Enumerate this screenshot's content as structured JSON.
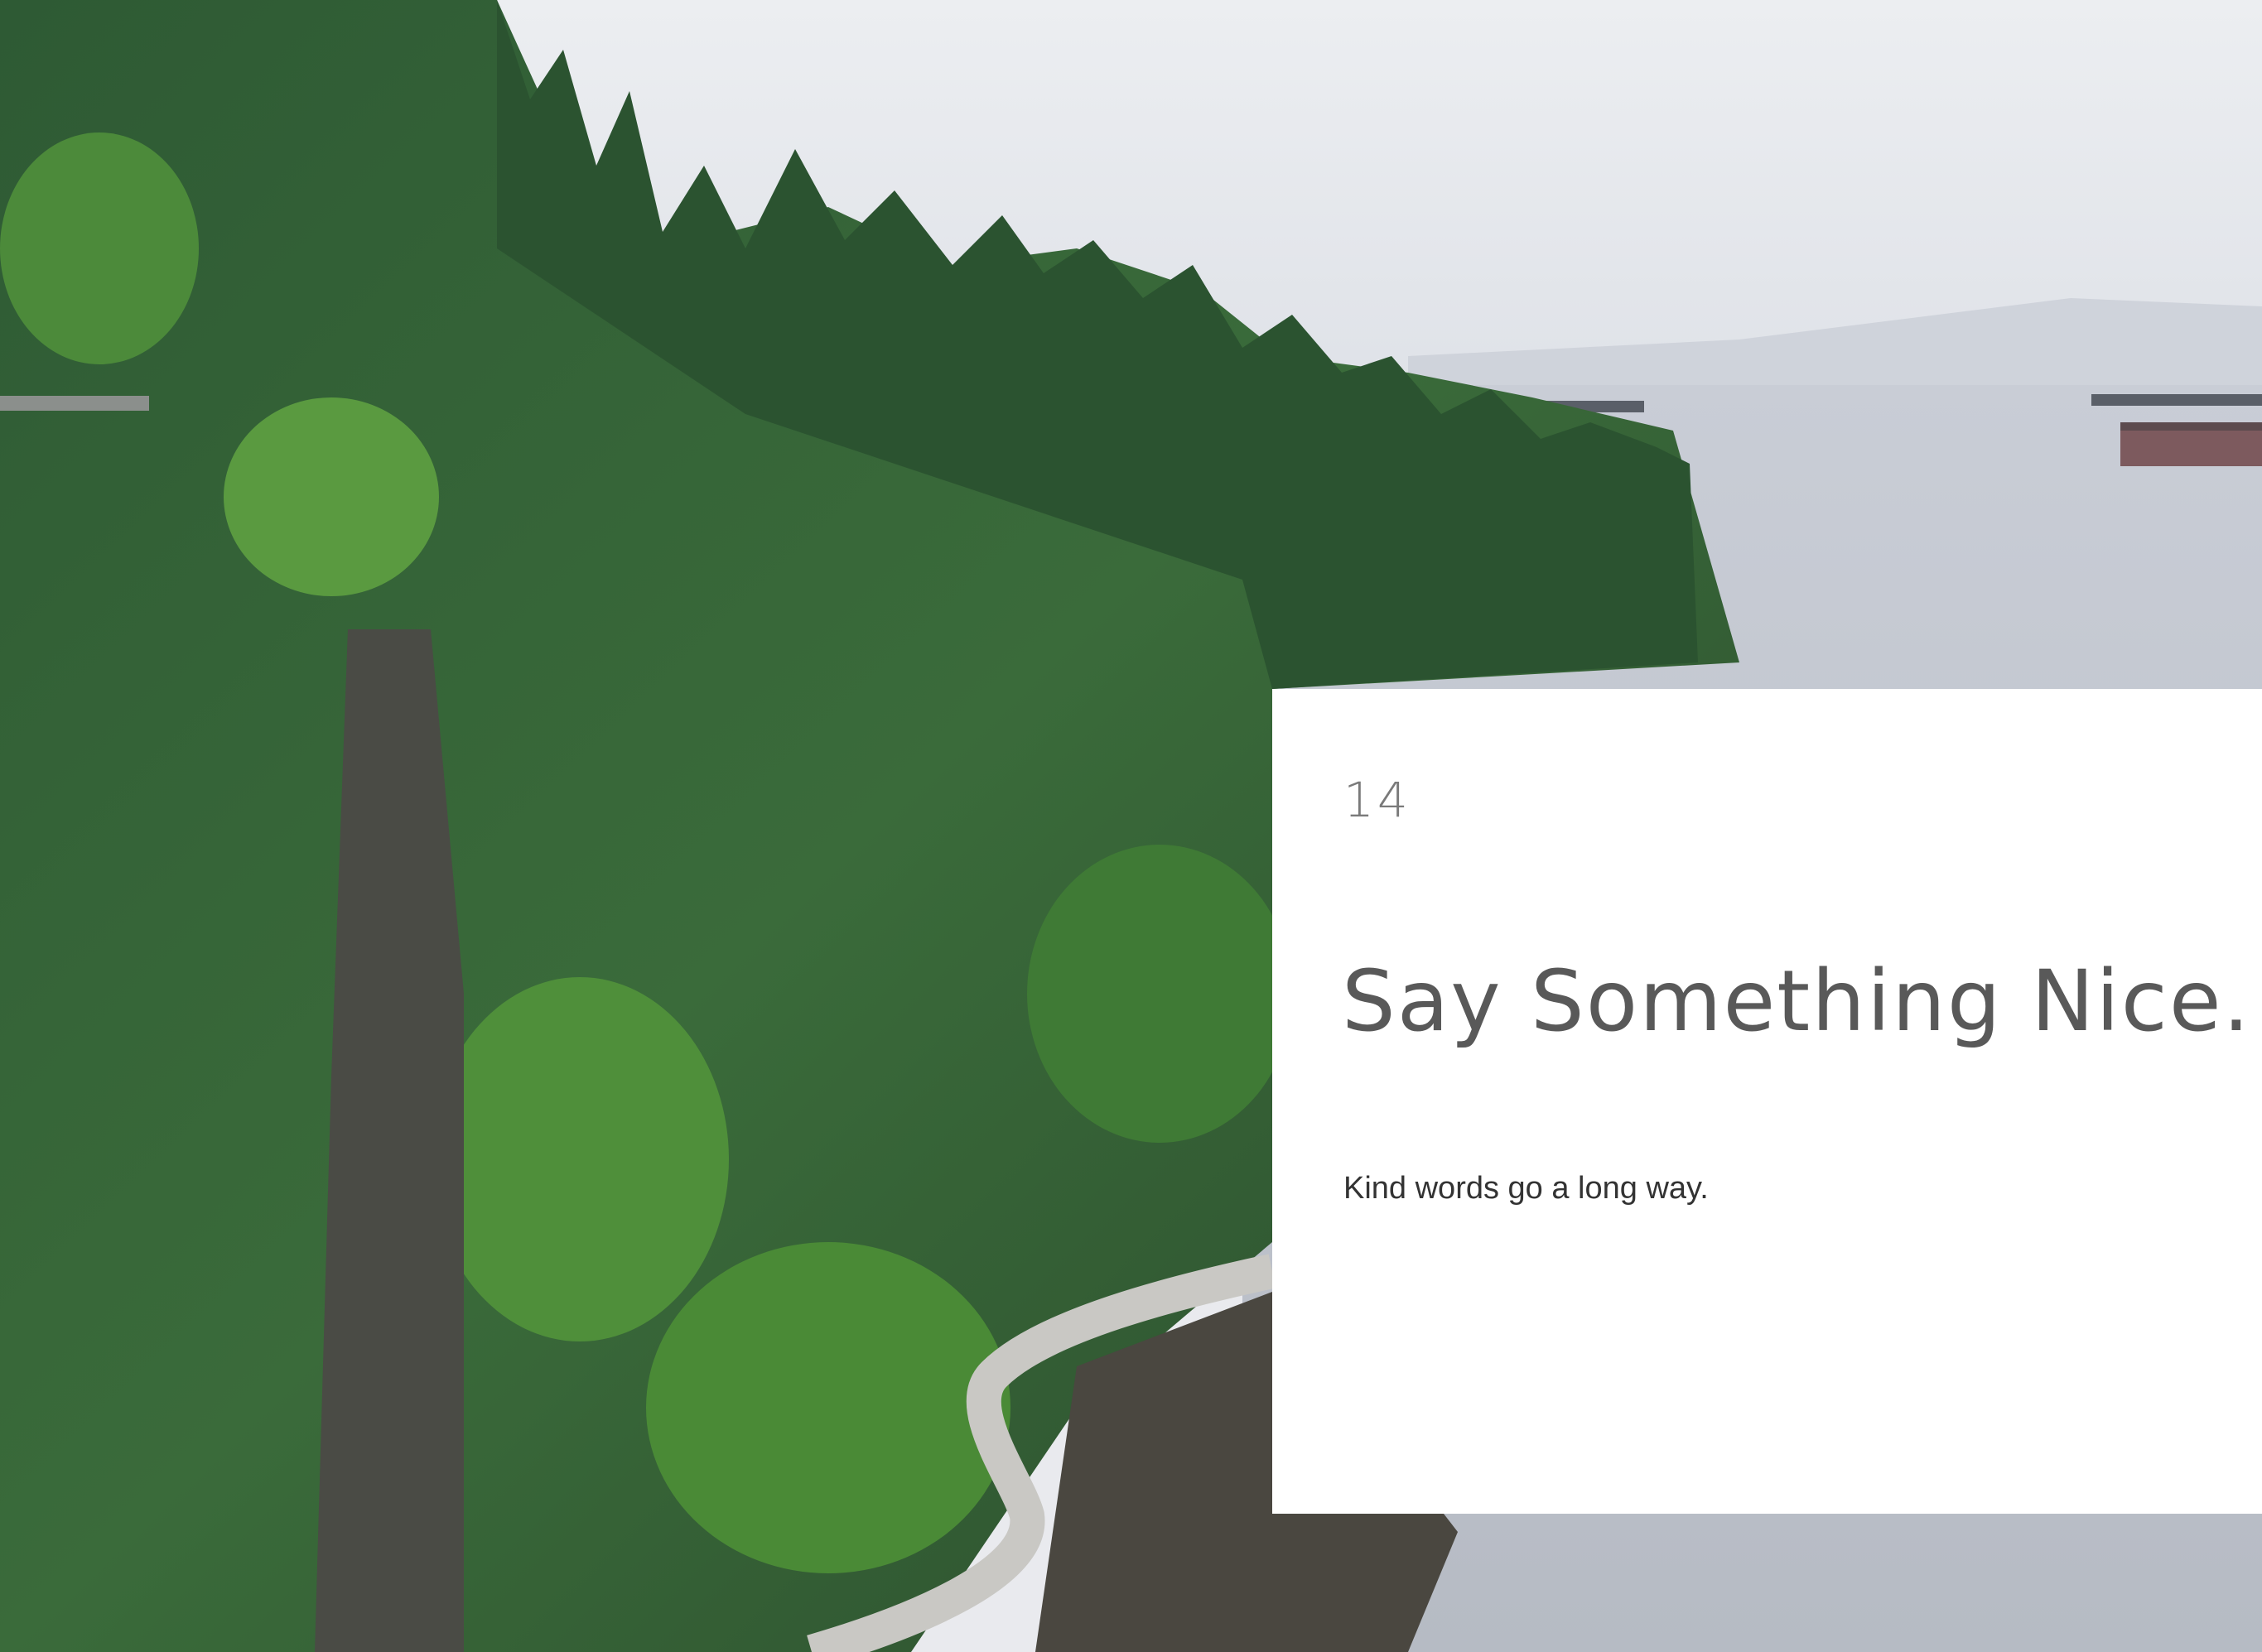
{
  "page": {
    "number": "14",
    "title": "Say Something Nice.",
    "subtitle": "Kind words go a long way."
  },
  "photo": {
    "subject": "forested-cliff-seawall-photo"
  },
  "colors": {
    "card_background": "#ffffff",
    "page_number": "#7a7a7a",
    "title": "#595959",
    "subtitle": "#333333"
  }
}
